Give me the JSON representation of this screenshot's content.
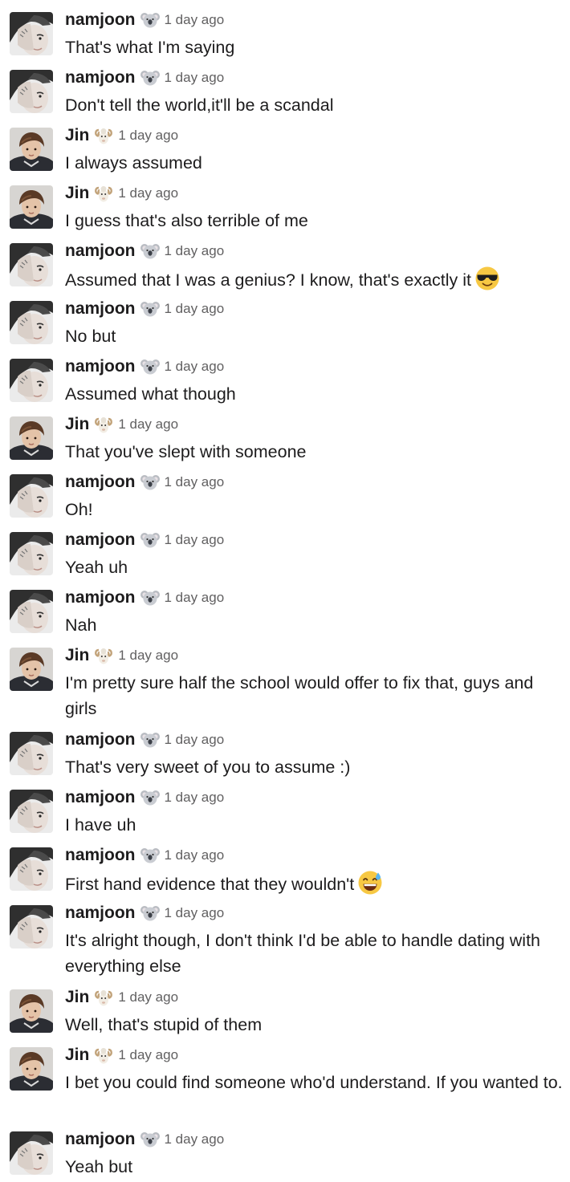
{
  "messages": [
    {
      "user": "namjoon",
      "badge": "koala",
      "time": "1 day ago",
      "text": "That's what I'm saying"
    },
    {
      "user": "namjoon",
      "badge": "koala",
      "time": "1 day ago",
      "text": "Don't tell the world,it'll be a scandal"
    },
    {
      "user": "Jin",
      "badge": "ram",
      "time": "1 day ago",
      "text": "I always assumed"
    },
    {
      "user": "Jin",
      "badge": "ram",
      "time": "1 day ago",
      "text": "I guess that's also terrible of me"
    },
    {
      "user": "namjoon",
      "badge": "koala",
      "time": "1 day ago",
      "text": "Assumed that I was a genius? I know, that's exactly it",
      "inline_emoji": "sunglasses-face"
    },
    {
      "user": "namjoon",
      "badge": "koala",
      "time": "1 day ago",
      "text": "No but"
    },
    {
      "user": "namjoon",
      "badge": "koala",
      "time": "1 day ago",
      "text": "Assumed what though"
    },
    {
      "user": "Jin",
      "badge": "ram",
      "time": "1 day ago",
      "text": "That you've slept with someone"
    },
    {
      "user": "namjoon",
      "badge": "koala",
      "time": "1 day ago",
      "text": "Oh!"
    },
    {
      "user": "namjoon",
      "badge": "koala",
      "time": "1 day ago",
      "text": "Yeah uh"
    },
    {
      "user": "namjoon",
      "badge": "koala",
      "time": "1 day ago",
      "text": "Nah"
    },
    {
      "user": "Jin",
      "badge": "ram",
      "time": "1 day ago",
      "text": "I'm pretty sure half the school would offer to fix that, guys and girls"
    },
    {
      "user": "namjoon",
      "badge": "koala",
      "time": "1 day ago",
      "text": "That's very sweet of you to assume :)"
    },
    {
      "user": "namjoon",
      "badge": "koala",
      "time": "1 day ago",
      "text": "I have uh"
    },
    {
      "user": "namjoon",
      "badge": "koala",
      "time": "1 day ago",
      "text": "First hand evidence that they wouldn't",
      "inline_emoji": "grinning-sweat-face"
    },
    {
      "user": "namjoon",
      "badge": "koala",
      "time": "1 day ago",
      "text": "It's alright though, I don't think I'd be able to handle dating with everything else"
    },
    {
      "user": "Jin",
      "badge": "ram",
      "time": "1 day ago",
      "text": "Well, that's stupid of them"
    },
    {
      "user": "Jin",
      "badge": "ram",
      "time": "1 day ago",
      "text": "I bet you could find someone who'd understand. If you wanted to."
    },
    {
      "user": "namjoon",
      "badge": "koala",
      "time": "1 day ago",
      "text": "Yeah but"
    }
  ]
}
